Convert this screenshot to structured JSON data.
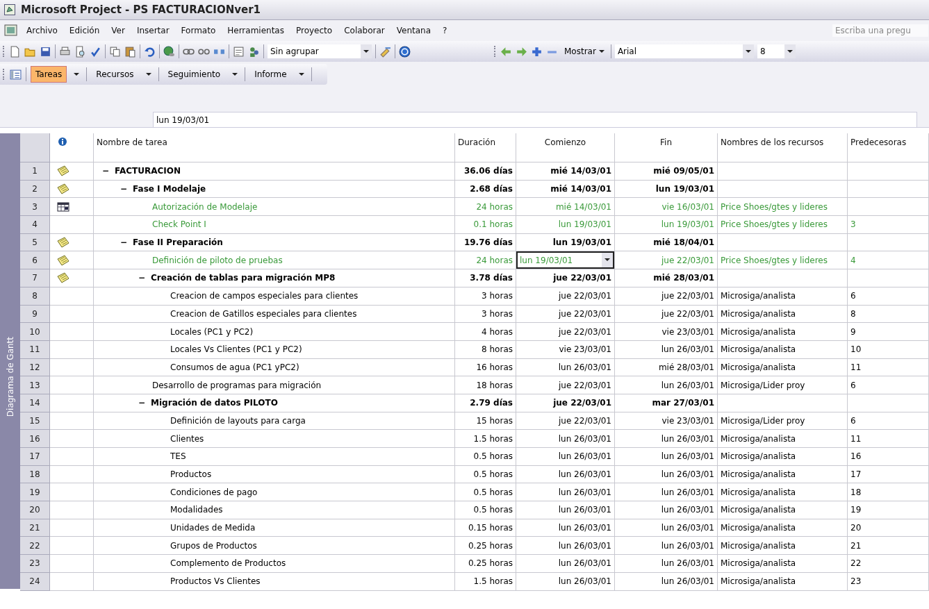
{
  "window": {
    "title": "Microsoft Project - PS FACTURACIONver1"
  },
  "menu": [
    "Archivo",
    "Edición",
    "Ver",
    "Insertar",
    "Formato",
    "Herramientas",
    "Proyecto",
    "Colaborar",
    "Ventana",
    "?"
  ],
  "help_search": {
    "placeholder": "Escriba una pregu"
  },
  "standard_toolbar": {
    "group_by": "Sin agrupar"
  },
  "formatting_toolbar": {
    "show_menu": "Mostrar",
    "font": "Arial",
    "font_size": "8"
  },
  "view_toolbar": {
    "tabs": [
      {
        "label": "Tareas",
        "selected": true
      },
      {
        "label": "Recursos",
        "selected": false
      },
      {
        "label": "Seguimiento",
        "selected": false
      },
      {
        "label": "Informe",
        "selected": false
      }
    ]
  },
  "entry_bar": {
    "value": "lun 19/03/01"
  },
  "view_bar": {
    "label": "Diagrama de Gantt"
  },
  "table": {
    "columns": [
      "Nombre de tarea",
      "Duración",
      "Comienzo",
      "Fin",
      "Nombres de los recursos",
      "Predecesoras"
    ],
    "tasks": [
      {
        "id": "1",
        "indicator": {
          "kind": "note"
        },
        "kind": "summary",
        "toggle": "−",
        "name": "FACTURACION",
        "duration": "36.06 días",
        "start": "mié 14/03/01",
        "finish": "mié 09/05/01",
        "color": "#000000",
        "editing": false,
        "children": [
          {
            "id": "2",
            "indicator": {
              "kind": "note"
            },
            "kind": "summary",
            "toggle": "−",
            "name": "Fase I Modelaje",
            "duration": "2.68 días",
            "start": "mié 14/03/01",
            "finish": "lun 19/03/01",
            "color": "#000000",
            "editing": false,
            "children": [
              {
                "id": "3",
                "indicator": {
                  "kind": "calendar"
                },
                "kind": "task",
                "name": "Autorización de Modelaje",
                "duration": "24 horas",
                "start": "mié 14/03/01",
                "finish": "vie 16/03/01",
                "resources": "Price Shoes/gtes y lideres",
                "color": "#3a9a3a",
                "editing": false
              },
              {
                "id": "4",
                "kind": "task",
                "name": "Check Point I",
                "duration": "0.1 horas",
                "start": "lun 19/03/01",
                "finish": "lun 19/03/01",
                "resources": "Price Shoes/gtes y lideres",
                "predecessors": "3",
                "color": "#3a9a3a",
                "editing": false
              }
            ]
          },
          {
            "id": "5",
            "indicator": {
              "kind": "note"
            },
            "kind": "summary",
            "toggle": "−",
            "name": "Fase II Preparación",
            "duration": "19.76 días",
            "start": "lun 19/03/01",
            "finish": "mié 18/04/01",
            "color": "#000000",
            "editing": false,
            "children": [
              {
                "id": "6",
                "indicator": {
                  "kind": "note"
                },
                "kind": "task",
                "name": "Definición de  piloto de pruebas",
                "duration": "24 horas",
                "start": "lun 19/03/01",
                "finish": "jue 22/03/01",
                "resources": "Price Shoes/gtes y lideres",
                "predecessors": "4",
                "color": "#3a9a3a",
                "editing": true
              },
              {
                "id": "7",
                "indicator": {
                  "kind": "note"
                },
                "kind": "summary",
                "toggle": "−",
                "name": "Creación de tablas para migración MP8",
                "duration": "3.78 días",
                "start": "jue 22/03/01",
                "finish": "mié 28/03/01",
                "color": "#000000",
                "editing": false,
                "children": [
                  {
                    "id": "8",
                    "kind": "task",
                    "name": "Creacion de campos especiales para clientes",
                    "duration": "3 horas",
                    "start": "jue 22/03/01",
                    "finish": "jue 22/03/01",
                    "resources": "Microsiga/analista",
                    "predecessors": "6",
                    "color": "#000000",
                    "editing": false
                  },
                  {
                    "id": "9",
                    "kind": "task",
                    "name": "Creacion de Gatillos especiales para clientes",
                    "duration": "3 horas",
                    "start": "jue 22/03/01",
                    "finish": "jue 22/03/01",
                    "resources": "Microsiga/analista",
                    "predecessors": "8",
                    "color": "#000000",
                    "editing": false
                  },
                  {
                    "id": "10",
                    "kind": "task",
                    "name": "Locales (PC1 y PC2)",
                    "duration": "4 horas",
                    "start": "jue 22/03/01",
                    "finish": "vie 23/03/01",
                    "resources": "Microsiga/analista",
                    "predecessors": "9",
                    "color": "#000000",
                    "editing": false
                  },
                  {
                    "id": "11",
                    "kind": "task",
                    "name": "Locales Vs Clientes (PC1 y PC2)",
                    "duration": "8 horas",
                    "start": "vie 23/03/01",
                    "finish": "lun 26/03/01",
                    "resources": "Microsiga/analista",
                    "predecessors": "10",
                    "color": "#000000",
                    "editing": false
                  },
                  {
                    "id": "12",
                    "kind": "task",
                    "name": "Consumos de agua (PC1 yPC2)",
                    "duration": "16 horas",
                    "start": "lun 26/03/01",
                    "finish": "mié 28/03/01",
                    "resources": "Microsiga/analista",
                    "predecessors": "11",
                    "color": "#000000",
                    "editing": false
                  }
                ]
              },
              {
                "id": "13",
                "kind": "task",
                "name": "Desarrollo de programas para migración",
                "duration": "18 horas",
                "start": "jue 22/03/01",
                "finish": "lun 26/03/01",
                "resources": "Microsiga/Lider proy",
                "predecessors": "6",
                "color": "#000000",
                "editing": false
              },
              {
                "id": "14",
                "kind": "summary",
                "toggle": "−",
                "name": "Migración de datos PILOTO",
                "duration": "2.79 días",
                "start": "jue 22/03/01",
                "finish": "mar 27/03/01",
                "color": "#000000",
                "editing": false,
                "children": [
                  {
                    "id": "15",
                    "kind": "task",
                    "name": "Definición de layouts para carga",
                    "duration": "15 horas",
                    "start": "jue 22/03/01",
                    "finish": "vie 23/03/01",
                    "resources": "Microsiga/Lider proy",
                    "predecessors": "6",
                    "color": "#000000",
                    "editing": false
                  },
                  {
                    "id": "16",
                    "kind": "task",
                    "name": "Clientes",
                    "duration": "1.5 horas",
                    "start": "lun 26/03/01",
                    "finish": "lun 26/03/01",
                    "resources": "Microsiga/analista",
                    "predecessors": "11",
                    "color": "#000000",
                    "editing": false
                  },
                  {
                    "id": "17",
                    "kind": "task",
                    "name": "TES",
                    "duration": "0.5 horas",
                    "start": "lun 26/03/01",
                    "finish": "lun 26/03/01",
                    "resources": "Microsiga/analista",
                    "predecessors": "16",
                    "color": "#000000",
                    "editing": false
                  },
                  {
                    "id": "18",
                    "kind": "task",
                    "name": "Productos",
                    "duration": "0.5 horas",
                    "start": "lun 26/03/01",
                    "finish": "lun 26/03/01",
                    "resources": "Microsiga/analista",
                    "predecessors": "17",
                    "color": "#000000",
                    "editing": false
                  },
                  {
                    "id": "19",
                    "kind": "task",
                    "name": "Condiciones de pago",
                    "duration": "0.5 horas",
                    "start": "lun 26/03/01",
                    "finish": "lun 26/03/01",
                    "resources": "Microsiga/analista",
                    "predecessors": "18",
                    "color": "#000000",
                    "editing": false
                  },
                  {
                    "id": "20",
                    "kind": "task",
                    "name": "Modalidades",
                    "duration": "0.5 horas",
                    "start": "lun 26/03/01",
                    "finish": "lun 26/03/01",
                    "resources": "Microsiga/analista",
                    "predecessors": "19",
                    "color": "#000000",
                    "editing": false
                  },
                  {
                    "id": "21",
                    "kind": "task",
                    "name": "Unidades de Medida",
                    "duration": "0.15 horas",
                    "start": "lun 26/03/01",
                    "finish": "lun 26/03/01",
                    "resources": "Microsiga/analista",
                    "predecessors": "20",
                    "color": "#000000",
                    "editing": false
                  },
                  {
                    "id": "22",
                    "kind": "task",
                    "name": "Grupos de Productos",
                    "duration": "0.25 horas",
                    "start": "lun 26/03/01",
                    "finish": "lun 26/03/01",
                    "resources": "Microsiga/analista",
                    "predecessors": "21",
                    "color": "#000000",
                    "editing": false
                  },
                  {
                    "id": "23",
                    "kind": "task",
                    "name": "Complemento de Productos",
                    "duration": "0.25 horas",
                    "start": "lun 26/03/01",
                    "finish": "lun 26/03/01",
                    "resources": "Microsiga/analista",
                    "predecessors": "22",
                    "color": "#000000",
                    "editing": false
                  },
                  {
                    "id": "24",
                    "kind": "task",
                    "name": "Productos Vs Clientes",
                    "duration": "1.5 horas",
                    "start": "lun 26/03/01",
                    "finish": "lun 26/03/01",
                    "resources": "Microsiga/analista",
                    "predecessors": "23",
                    "color": "#000000",
                    "editing": false
                  }
                ]
              }
            ]
          }
        ]
      }
    ]
  }
}
